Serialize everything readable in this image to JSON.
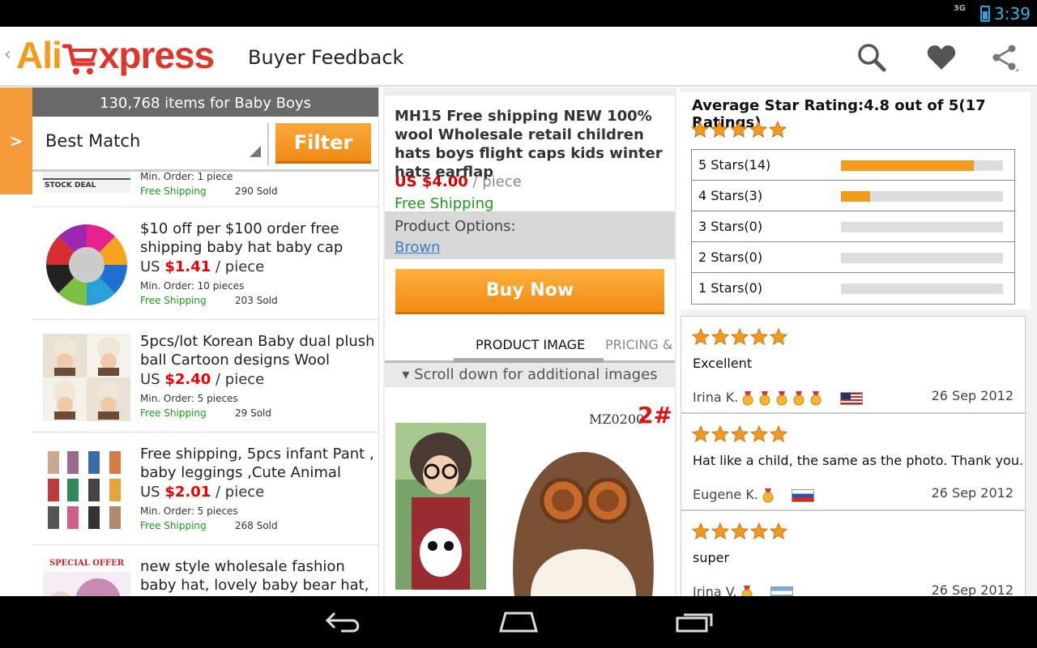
{
  "status_bar": {
    "network": "3G",
    "time": "3:39"
  },
  "action_bar": {
    "logo_part1": "Ali",
    "logo_part2": "xpress",
    "screen_title": "Buyer Feedback",
    "icons": [
      "search-icon",
      "heart-icon",
      "share-icon"
    ]
  },
  "drawer_tab": {
    "label": ">"
  },
  "results": {
    "header": "130,768 items for Baby Boys",
    "sort_value": "Best Match",
    "filter_label": "Filter",
    "partial_item": {
      "min_order": "Min. Order: 1 piece",
      "shipping": "Free Shipping",
      "sold": "290 Sold",
      "thumb_text": "STOCK DEAL"
    },
    "items": [
      {
        "title": "$10 off per $100 order free shipping baby hat baby cap",
        "price_prefix": "US ",
        "price": "$1.41",
        "price_unit": " / piece",
        "min_order": "Min. Order: 10 pieces",
        "shipping": "Free Shipping",
        "sold": "203 Sold"
      },
      {
        "title": "5pcs/lot Korean Baby dual plush ball Cartoon designs Wool",
        "price_prefix": "US ",
        "price": "$2.40",
        "price_unit": " / piece",
        "min_order": "Min. Order: 5 pieces",
        "shipping": "Free Shipping",
        "sold": "29 Sold"
      },
      {
        "title": "Free shipping, 5pcs infant Pant , baby leggings ,Cute Animal",
        "price_prefix": "US ",
        "price": "$2.01",
        "price_unit": " / piece",
        "min_order": "Min. Order: 5 pieces",
        "shipping": "Free Shipping",
        "sold": "268 Sold"
      },
      {
        "title": "new style wholesale fashion baby hat, lovely baby bear hat,",
        "thumb_text": "SPECIAL OFFER"
      }
    ]
  },
  "product": {
    "title": "MH15 Free shipping  NEW 100% wool Wholesale  retail children hats boys flight caps kids winter hats earflap",
    "price": "US $4.00",
    "price_unit": " / piece",
    "shipping": "Free Shipping",
    "options_label": "Product Options:",
    "option_value": "Brown",
    "buy_label": "Buy Now",
    "tabs": [
      "PRODUCT IMAGE",
      "PRICING &"
    ],
    "scroll_hint": "▾ Scroll down for additional images",
    "image_label": "MZ0200",
    "image_badge": "2#"
  },
  "feedback": {
    "avg_label": "Average Star Rating:4.8 out of 5(17 Ratings)",
    "avg_stars": 5,
    "breakdown": [
      {
        "label": "5 Stars(14)",
        "fraction": 0.82
      },
      {
        "label": "4 Stars(3)",
        "fraction": 0.18
      },
      {
        "label": "3 Stars(0)",
        "fraction": 0
      },
      {
        "label": "2 Stars(0)",
        "fraction": 0
      },
      {
        "label": "1 Stars(0)",
        "fraction": 0
      }
    ],
    "reviews": [
      {
        "stars": 5,
        "text": "Excellent",
        "author": "Irina K.",
        "medals": 5,
        "flag": "us",
        "date": "26 Sep 2012"
      },
      {
        "stars": 5,
        "text": "Hat like a child, the same as the photo. Thank you.",
        "author": "Eugene K.",
        "medals": 1,
        "flag": "ru",
        "date": "26 Sep 2012"
      },
      {
        "stars": 5,
        "text": "super",
        "author": "Irina V.",
        "medals": 1,
        "flag": "ar",
        "date": "26 Sep 2012"
      }
    ]
  },
  "colors": {
    "accent": "#f39a1e",
    "price_red": "#e00000",
    "ship_green": "#1a9a1a",
    "link_blue": "#3b7fc4"
  }
}
